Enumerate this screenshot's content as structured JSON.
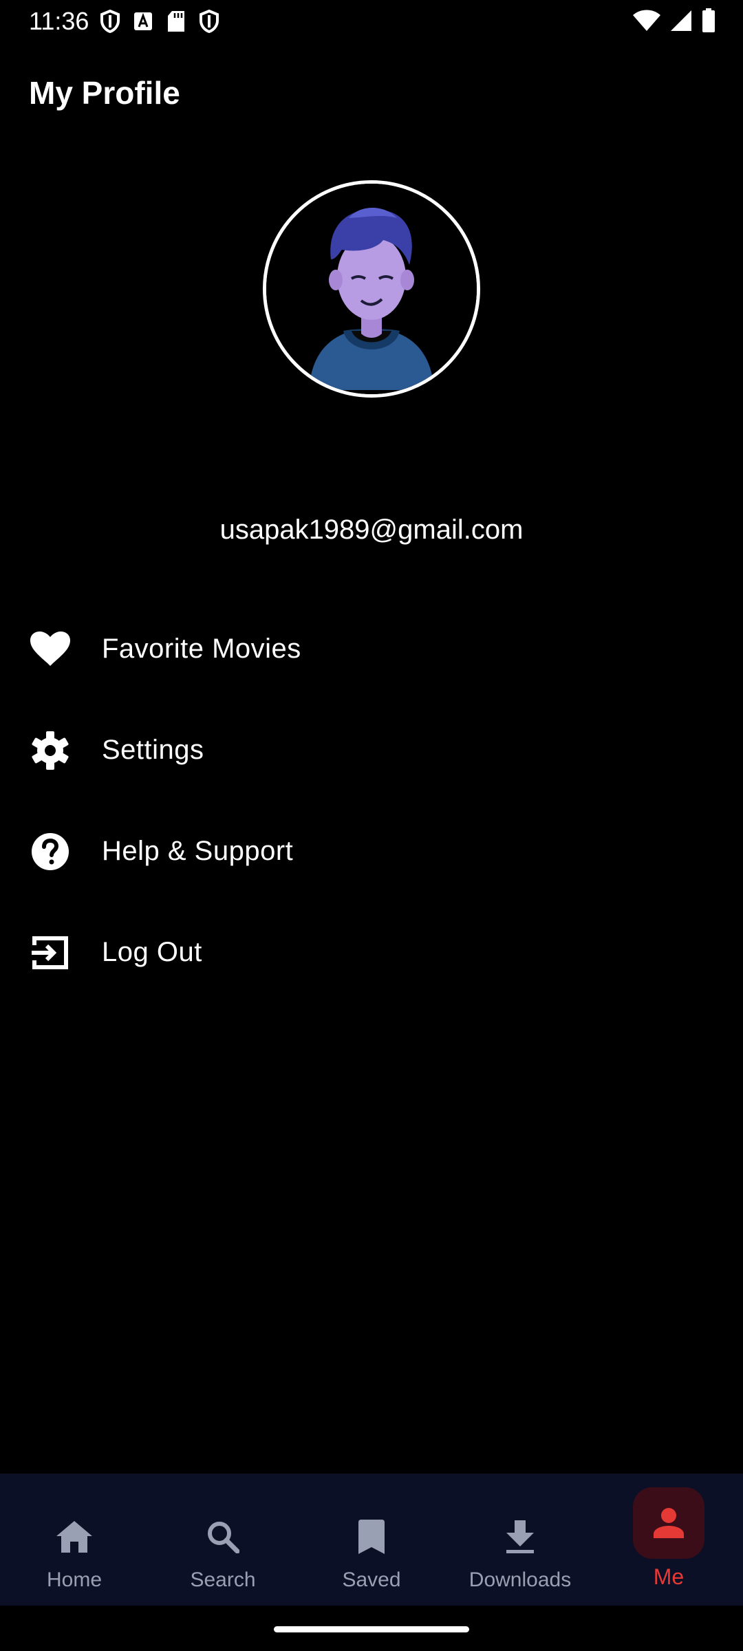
{
  "status_bar": {
    "time": "11:36"
  },
  "header": {
    "title": "My Profile"
  },
  "profile": {
    "email": "usapak1989@gmail.com"
  },
  "menu": [
    {
      "label": "Favorite Movies",
      "icon": "heart-icon"
    },
    {
      "label": "Settings",
      "icon": "gear-icon"
    },
    {
      "label": "Help & Support",
      "icon": "help-icon"
    },
    {
      "label": "Log Out",
      "icon": "logout-icon"
    }
  ],
  "bottom_nav": {
    "items": [
      {
        "label": "Home",
        "icon": "home-icon"
      },
      {
        "label": "Search",
        "icon": "search-icon"
      },
      {
        "label": "Saved",
        "icon": "bookmark-icon"
      },
      {
        "label": "Downloads",
        "icon": "download-icon"
      },
      {
        "label": "Me",
        "icon": "person-icon"
      }
    ],
    "active": "Me"
  },
  "colors": {
    "accent": "#e53935",
    "background": "#000000",
    "nav_background": "#0b1026",
    "nav_inactive": "#9aa0b3"
  }
}
